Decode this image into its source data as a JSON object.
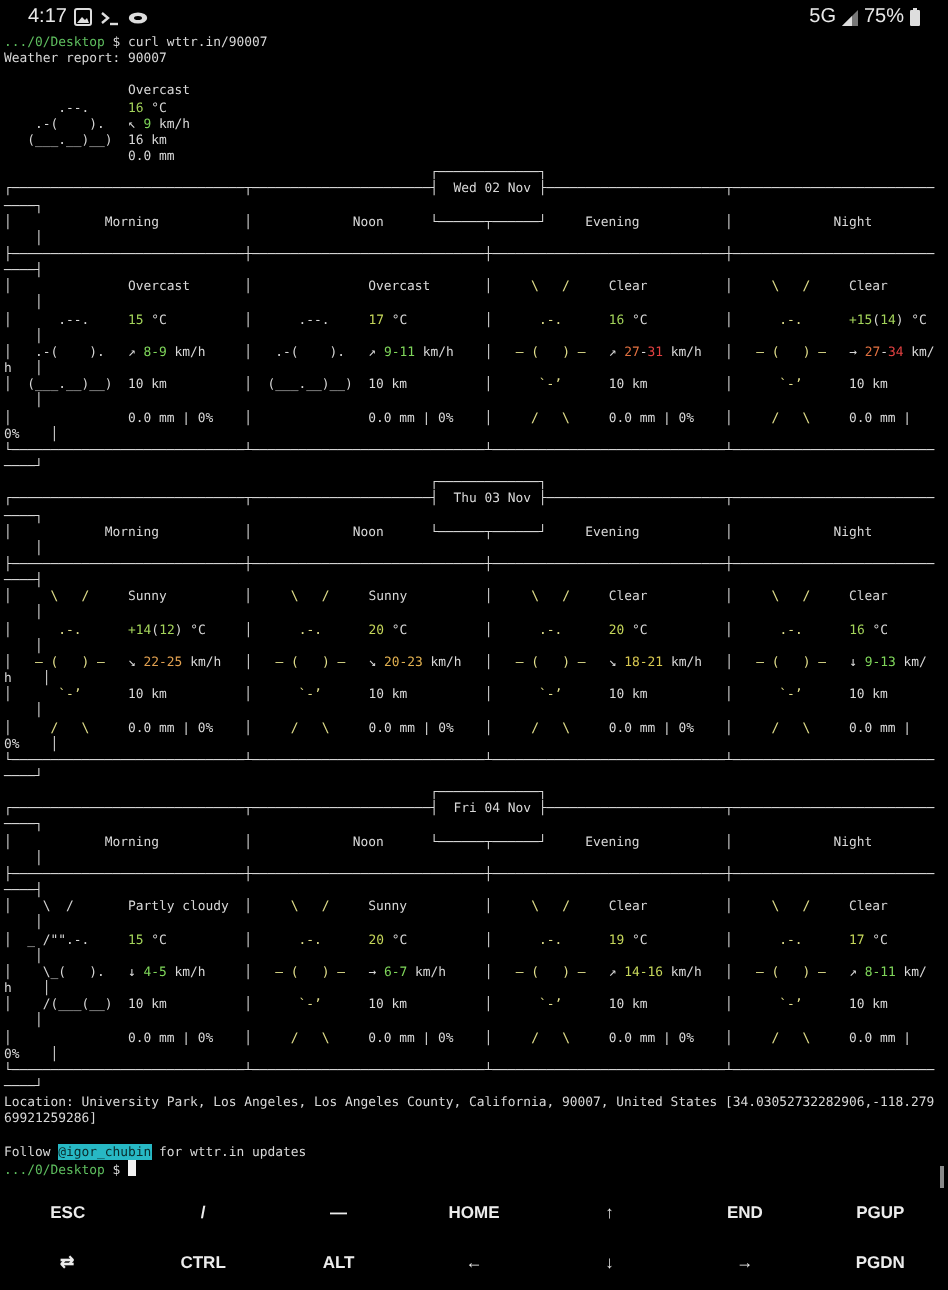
{
  "status_bar": {
    "time": "4:17",
    "network": "5G",
    "battery": "75%"
  },
  "terminal": {
    "lines": [
      {
        "segments": [
          {
            "text": ".../0/Desktop",
            "color": "#5fbf5f"
          },
          {
            "text": " $ curl wttr.in/90007"
          }
        ]
      },
      {
        "segments": [
          {
            "text": "Weather report: 90007"
          }
        ]
      },
      {
        "blank": true
      },
      {
        "segments": [
          {
            "text": "                Overcast"
          }
        ]
      },
      {
        "segments": [
          {
            "text": "       .--.     "
          },
          {
            "text": "16",
            "color": "#a3d35a"
          },
          {
            "text": " °C"
          }
        ]
      },
      {
        "segments": [
          {
            "text": "    .-(    ).   ↖ "
          },
          {
            "text": "9",
            "color": "#7fd65a"
          },
          {
            "text": " km/h"
          }
        ]
      },
      {
        "segments": [
          {
            "text": "   (___.__)__)  16 km"
          }
        ]
      },
      {
        "segments": [
          {
            "text": "                0.0 mm"
          }
        ]
      },
      {
        "segments": [
          {
            "text": "                                                       ┌─────────────┐"
          }
        ]
      },
      {
        "segments": [
          {
            "text": "┌──────────────────────────────┬───────────────────────┤  Wed 02 Nov ├───────────────────────┬──────────────────────────────┐"
          }
        ]
      },
      {
        "segments": [
          {
            "text": "│            Morning           │             Noon      └──────┬──────┘     Evening           │             Night            │"
          }
        ]
      },
      {
        "segments": [
          {
            "text": "├──────────────────────────────┼──────────────────────────────┼──────────────────────────────┼──────────────────────────────┤"
          }
        ]
      },
      {
        "segments": [
          {
            "text": "│               Overcast       │               Overcast       │ "
          },
          {
            "text": "    \\   /    ",
            "kind": "sun"
          },
          {
            "text": " Clear          │ "
          },
          {
            "text": "    \\   /    ",
            "kind": "sun"
          },
          {
            "text": " Clear          │"
          }
        ]
      },
      {
        "segments": [
          {
            "text": "│      .--.     "
          },
          {
            "text": "15",
            "color": "#a3d35a"
          },
          {
            "text": " °C          │      .--.     "
          },
          {
            "text": "17",
            "color": "#c5d65a"
          },
          {
            "text": " °C          │ "
          },
          {
            "text": "     .-.      ",
            "kind": "sun"
          },
          {
            "text": "16",
            "color": "#a3d35a"
          },
          {
            "text": " °C          │ "
          },
          {
            "text": "     .-.      ",
            "kind": "sun"
          },
          {
            "text": "+15",
            "color": "#a3d35a"
          },
          {
            "text": "("
          },
          {
            "text": "14",
            "color": "#a3d35a"
          },
          {
            "text": ") °C     │"
          }
        ]
      },
      {
        "segments": [
          {
            "text": "│   .-(    ).   ↗ "
          },
          {
            "text": "8-9",
            "color": "#7fd65a"
          },
          {
            "text": " km/h     │   .-(    ).   ↗ "
          },
          {
            "text": "9-11",
            "color": "#7fd65a"
          },
          {
            "text": " km/h    │ "
          },
          {
            "text": "  ― (   ) ―  ",
            "kind": "sun"
          },
          {
            "text": " ↗ "
          },
          {
            "text": "27",
            "color": "#e07040"
          },
          {
            "text": "-"
          },
          {
            "text": "31",
            "color": "#e04040"
          },
          {
            "text": " km/h   │ "
          },
          {
            "text": "  ― (   ) ―  ",
            "kind": "sun"
          },
          {
            "text": " → "
          },
          {
            "text": "27",
            "color": "#e07040"
          },
          {
            "text": "-"
          },
          {
            "text": "34",
            "color": "#e04040"
          },
          {
            "text": " km/h   │"
          }
        ]
      },
      {
        "segments": [
          {
            "text": "│  (___.__)__)  10 km          │  (___.__)__)  10 km          │ "
          },
          {
            "text": "     `-’     ",
            "kind": "sun"
          },
          {
            "text": " 10 km          │ "
          },
          {
            "text": "     `-’     ",
            "kind": "sun"
          },
          {
            "text": " 10 km          │"
          }
        ]
      },
      {
        "segments": [
          {
            "text": "│               0.0 mm | 0%    │               0.0 mm | 0%    │ "
          },
          {
            "text": "    /   \\    ",
            "kind": "sun"
          },
          {
            "text": " 0.0 mm | 0%    │ "
          },
          {
            "text": "    /   \\    ",
            "kind": "sun"
          },
          {
            "text": " 0.0 mm | 0%    │"
          }
        ]
      },
      {
        "segments": [
          {
            "text": "└──────────────────────────────┴──────────────────────────────┴──────────────────────────────┴──────────────────────────────┘"
          }
        ]
      },
      {
        "segments": [
          {
            "text": "                                                       ┌─────────────┐"
          }
        ]
      },
      {
        "segments": [
          {
            "text": "┌──────────────────────────────┬───────────────────────┤  Thu 03 Nov ├───────────────────────┬──────────────────────────────┐"
          }
        ]
      },
      {
        "segments": [
          {
            "text": "│            Morning           │             Noon      └──────┬──────┘     Evening           │             Night            │"
          }
        ]
      },
      {
        "segments": [
          {
            "text": "├──────────────────────────────┼──────────────────────────────┼──────────────────────────────┼──────────────────────────────┤"
          }
        ]
      },
      {
        "segments": [
          {
            "text": "│ "
          },
          {
            "text": "    \\   /    ",
            "kind": "sun"
          },
          {
            "text": " Sunny          │ "
          },
          {
            "text": "    \\   /    ",
            "kind": "sun"
          },
          {
            "text": " Sunny          │ "
          },
          {
            "text": "    \\   /    ",
            "kind": "sun"
          },
          {
            "text": " Clear          │ "
          },
          {
            "text": "    \\   /    ",
            "kind": "sun"
          },
          {
            "text": " Clear          │"
          }
        ]
      },
      {
        "segments": [
          {
            "text": "│ "
          },
          {
            "text": "     .-.      ",
            "kind": "sun"
          },
          {
            "text": "+14",
            "color": "#a3d35a"
          },
          {
            "text": "("
          },
          {
            "text": "12",
            "color": "#a3d35a"
          },
          {
            "text": ") °C     │ "
          },
          {
            "text": "     .-.      ",
            "kind": "sun"
          },
          {
            "text": "20",
            "color": "#c5d65a"
          },
          {
            "text": " °C          │ "
          },
          {
            "text": "     .-.      ",
            "kind": "sun"
          },
          {
            "text": "20",
            "color": "#c5d65a"
          },
          {
            "text": " °C          │ "
          },
          {
            "text": "     .-.      ",
            "kind": "sun"
          },
          {
            "text": "16",
            "color": "#a3d35a"
          },
          {
            "text": " °C          │"
          }
        ]
      },
      {
        "segments": [
          {
            "text": "│ "
          },
          {
            "text": "  ― (   ) ―  ",
            "kind": "sun"
          },
          {
            "text": " ↘ "
          },
          {
            "text": "22-25",
            "color": "#e0a050"
          },
          {
            "text": " km/h   │ "
          },
          {
            "text": "  ― (   ) ―  ",
            "kind": "sun"
          },
          {
            "text": " ↘ "
          },
          {
            "text": "20-23",
            "color": "#e0b050"
          },
          {
            "text": " km/h   │ "
          },
          {
            "text": "  ― (   ) ―  ",
            "kind": "sun"
          },
          {
            "text": " ↘ "
          },
          {
            "text": "18-21",
            "color": "#d8c850"
          },
          {
            "text": " km/h   │ "
          },
          {
            "text": "  ― (   ) ―  ",
            "kind": "sun"
          },
          {
            "text": " ↓ "
          },
          {
            "text": "9-13",
            "color": "#7fd65a"
          },
          {
            "text": " km/h    │"
          }
        ]
      },
      {
        "segments": [
          {
            "text": "│ "
          },
          {
            "text": "     `-’     ",
            "kind": "sun"
          },
          {
            "text": " 10 km          │ "
          },
          {
            "text": "     `-’     ",
            "kind": "sun"
          },
          {
            "text": " 10 km          │ "
          },
          {
            "text": "     `-’     ",
            "kind": "sun"
          },
          {
            "text": " 10 km          │ "
          },
          {
            "text": "     `-’     ",
            "kind": "sun"
          },
          {
            "text": " 10 km          │"
          }
        ]
      },
      {
        "segments": [
          {
            "text": "│ "
          },
          {
            "text": "    /   \\    ",
            "kind": "sun"
          },
          {
            "text": " 0.0 mm | 0%    │ "
          },
          {
            "text": "    /   \\    ",
            "kind": "sun"
          },
          {
            "text": " 0.0 mm | 0%    │ "
          },
          {
            "text": "    /   \\    ",
            "kind": "sun"
          },
          {
            "text": " 0.0 mm | 0%    │ "
          },
          {
            "text": "    /   \\    ",
            "kind": "sun"
          },
          {
            "text": " 0.0 mm | 0%    │"
          }
        ]
      },
      {
        "segments": [
          {
            "text": "└──────────────────────────────┴──────────────────────────────┴──────────────────────────────┴──────────────────────────────┘"
          }
        ]
      },
      {
        "segments": [
          {
            "text": "                                                       ┌─────────────┐"
          }
        ]
      },
      {
        "segments": [
          {
            "text": "┌──────────────────────────────┬───────────────────────┤  Fri 04 Nov ├───────────────────────┬──────────────────────────────┐"
          }
        ]
      },
      {
        "segments": [
          {
            "text": "│            Morning           │             Noon      └──────┬──────┘     Evening           │             Night            │"
          }
        ]
      },
      {
        "segments": [
          {
            "text": "├──────────────────────────────┼──────────────────────────────┼──────────────────────────────┼──────────────────────────────┤"
          }
        ]
      },
      {
        "segments": [
          {
            "text": "│    \\  /       Partly cloudy  │ "
          },
          {
            "text": "    \\   /    ",
            "kind": "sun"
          },
          {
            "text": " Sunny          │ "
          },
          {
            "text": "    \\   /    ",
            "kind": "sun"
          },
          {
            "text": " Clear          │ "
          },
          {
            "text": "    \\   /    ",
            "kind": "sun"
          },
          {
            "text": " Clear          │"
          }
        ]
      },
      {
        "segments": [
          {
            "text": "│  _ /\"\".-.     "
          },
          {
            "text": "15",
            "color": "#a3d35a"
          },
          {
            "text": " °C          │ "
          },
          {
            "text": "     .-.      ",
            "kind": "sun"
          },
          {
            "text": "20",
            "color": "#c5d65a"
          },
          {
            "text": " °C          │ "
          },
          {
            "text": "     .-.      ",
            "kind": "sun"
          },
          {
            "text": "19",
            "color": "#c5d65a"
          },
          {
            "text": " °C          │ "
          },
          {
            "text": "     .-.      ",
            "kind": "sun"
          },
          {
            "text": "17",
            "color": "#c5d65a"
          },
          {
            "text": " °C          │"
          }
        ]
      },
      {
        "segments": [
          {
            "text": "│    \\_(   ).   ↓ "
          },
          {
            "text": "4-5",
            "color": "#7fd65a"
          },
          {
            "text": " km/h     │ "
          },
          {
            "text": "  ― (   ) ―  ",
            "kind": "sun"
          },
          {
            "text": " → "
          },
          {
            "text": "6-7",
            "color": "#7fd65a"
          },
          {
            "text": " km/h     │ "
          },
          {
            "text": "  ― (   ) ―  ",
            "kind": "sun"
          },
          {
            "text": " ↗ "
          },
          {
            "text": "14-16",
            "color": "#c5d65a"
          },
          {
            "text": " km/h   │ "
          },
          {
            "text": "  ― (   ) ―  ",
            "kind": "sun"
          },
          {
            "text": " ↗ "
          },
          {
            "text": "8-11",
            "color": "#7fd65a"
          },
          {
            "text": " km/h    │"
          }
        ]
      },
      {
        "segments": [
          {
            "text": "│    /(___(__)  10 km          │ "
          },
          {
            "text": "     `-’     ",
            "kind": "sun"
          },
          {
            "text": " 10 km          │ "
          },
          {
            "text": "     `-’     ",
            "kind": "sun"
          },
          {
            "text": " 10 km          │ "
          },
          {
            "text": "     `-’     ",
            "kind": "sun"
          },
          {
            "text": " 10 km          │"
          }
        ]
      },
      {
        "segments": [
          {
            "text": "│               0.0 mm | 0%    │ "
          },
          {
            "text": "    /   \\    ",
            "kind": "sun"
          },
          {
            "text": " 0.0 mm | 0%    │ "
          },
          {
            "text": "    /   \\    ",
            "kind": "sun"
          },
          {
            "text": " 0.0 mm | 0%    │ "
          },
          {
            "text": "    /   \\    ",
            "kind": "sun"
          },
          {
            "text": " 0.0 mm | 0%    │"
          }
        ]
      },
      {
        "segments": [
          {
            "text": "└──────────────────────────────┴──────────────────────────────┴──────────────────────────────┴──────────────────────────────┘"
          }
        ]
      },
      {
        "segments": [
          {
            "text": "Location: University Park, Los Angeles, Los Angeles County, California, 90007, United States [34.03052732282906,-118.27969921259286]"
          }
        ]
      },
      {
        "blank": true
      },
      {
        "segments": [
          {
            "text": "Follow "
          },
          {
            "text": "@igor_chubin",
            "kind": "highlight"
          },
          {
            "text": " for wttr.in updates"
          }
        ]
      },
      {
        "segments": [
          {
            "text": ".../0/Desktop",
            "color": "#5fbf5f"
          },
          {
            "text": " $ "
          }
        ],
        "cursor": true
      }
    ]
  },
  "extra_keys": [
    [
      {
        "label": "ESC"
      },
      {
        "label": "/"
      },
      {
        "label": "―"
      },
      {
        "label": "HOME"
      },
      {
        "label": "↑"
      },
      {
        "label": "END"
      },
      {
        "label": "PGUP"
      }
    ],
    [
      {
        "label": "⇄"
      },
      {
        "label": "CTRL"
      },
      {
        "label": "ALT"
      },
      {
        "label": "←"
      },
      {
        "label": "↓"
      },
      {
        "label": "→"
      },
      {
        "label": "PGDN"
      }
    ]
  ]
}
